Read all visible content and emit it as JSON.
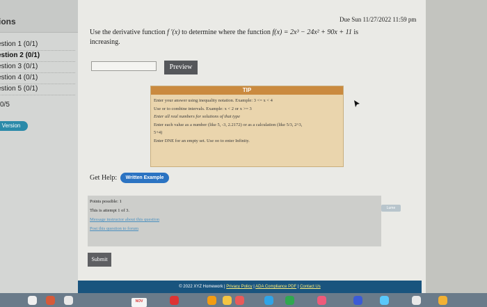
{
  "sidebar": {
    "header": "ions",
    "items": [
      {
        "label": "estion 1 (0/1)",
        "active": false
      },
      {
        "label": "estion 2 (0/1)",
        "active": true
      },
      {
        "label": "estion 3 (0/1)",
        "active": false
      },
      {
        "label": "estion 4 (0/1)",
        "active": false
      },
      {
        "label": "estion 5 (0/1)",
        "active": false
      }
    ],
    "score": "0/5",
    "version_label": "Version"
  },
  "due": "Due Sun 11/27/2022 11:59 pm",
  "question": {
    "prefix": "Use the derivative function ",
    "derivative": "f ′(x)",
    "middle": " to determine where the function ",
    "function": "f(x) = 2x³ − 24x² + 90x + 11",
    "suffix": " is increasing."
  },
  "answer": {
    "value": "",
    "preview_label": "Preview"
  },
  "tip": {
    "title": "TIP",
    "lines": [
      "Enter your answer using inequality notation. Example: 3 <= x < 4",
      "Use or to combine intervals. Example: x < 2 or x >= 3",
      "Enter all real numbers for solutions of that type",
      "Enter each value as a number (like 5, -3, 2.2172) or as a calculation (like 5/3, 2^3,",
      "5+4)",
      "Enter DNE for an empty set. Use oo to enter Infinity."
    ]
  },
  "help": {
    "label": "Get Help:",
    "written_example_label": "Written Example"
  },
  "info": {
    "points": "Points possible: 1",
    "attempt": "This is attempt 1 of 3.",
    "message_link": "Message instructor about this question",
    "forum_link": "Post this question to forum"
  },
  "submit_label": "Submit",
  "footer": {
    "copyright": "© 2022 XYZ Homework | ",
    "privacy": "Privacy Policy",
    "ada": "ADA Compliance PDF",
    "contact": "Contact Us"
  },
  "scroll_badge": "Lume",
  "taskbar": {
    "calendar_month": "NOV"
  },
  "colors": {
    "accent_blue": "#2b73c2",
    "footer_blue": "#19547e",
    "tip_orange": "#ca8a3f"
  }
}
